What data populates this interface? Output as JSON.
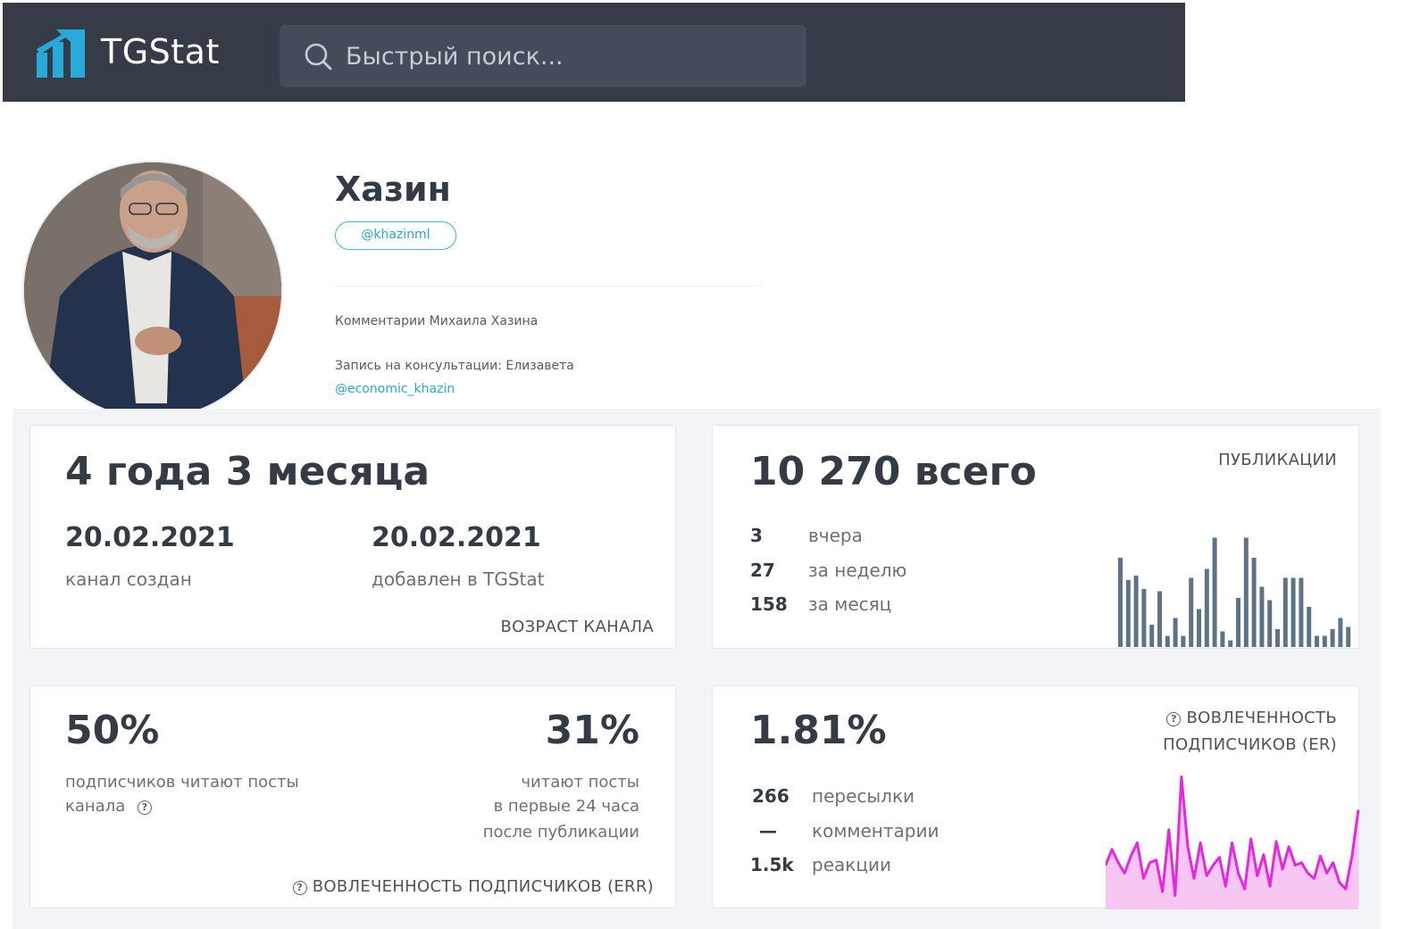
{
  "header": {
    "brand": "TGStat",
    "search_placeholder": "Быстрый поиск..."
  },
  "profile": {
    "name": "Хазин",
    "username": "@khazinml",
    "description": "Комментарии Михаила Хазина",
    "booking_text": "Запись на консультации: Елизавета",
    "booking_link": "@economic_khazin"
  },
  "age_card": {
    "value": "4 года 3 месяца",
    "created_date": "20.02.2021",
    "created_label": "канал создан",
    "added_date": "20.02.2021",
    "added_label": "добавлен в TGStat",
    "caption": "ВОЗРАСТ КАНАЛА"
  },
  "posts_card": {
    "value": "10 270 всего",
    "caption": "ПУБЛИКАЦИИ",
    "rows": [
      {
        "num": "3",
        "label": "вчера"
      },
      {
        "num": "27",
        "label": "за неделю"
      },
      {
        "num": "158",
        "label": "за месяц"
      }
    ],
    "bars": [
      4,
      3,
      3.2,
      2.6,
      1,
      2.5,
      0.5,
      1.3,
      0.5,
      3.1,
      1.7,
      3.5,
      4.9,
      0.7,
      0.3,
      2.2,
      4.9,
      4.0,
      2.7,
      2.1,
      0.8,
      3.1,
      3.1,
      3.1,
      1.8,
      0.5,
      0.5,
      0.8,
      1.3,
      0.9
    ]
  },
  "err_card": {
    "value_left": "50%",
    "label_left_1": "подписчиков читают посты",
    "label_left_2": "канала",
    "value_right": "31%",
    "label_right_1": "читают посты",
    "label_right_2": "в первые 24 часа",
    "label_right_3": "после публикации",
    "caption": "ВОВЛЕЧЕННОСТЬ ПОДПИСЧИКОВ (ERR)"
  },
  "er_card": {
    "value": "1.81%",
    "caption_1": "ВОВЛЕЧЕННОСТЬ",
    "caption_2": "ПОДПИСЧИКОВ (ER)",
    "rows": [
      {
        "num": "266",
        "label": "пересылки"
      },
      {
        "num": "—",
        "label": "комментарии"
      },
      {
        "num": "1.5k",
        "label": "реакции"
      }
    ],
    "line": [
      0.28,
      0.4,
      0.3,
      0.22,
      0.35,
      0.45,
      0.18,
      0.3,
      0.32,
      0.08,
      0.55,
      0.05,
      0.95,
      0.42,
      0.18,
      0.45,
      0.2,
      0.28,
      0.34,
      0.12,
      0.45,
      0.22,
      0.1,
      0.48,
      0.2,
      0.36,
      0.12,
      0.46,
      0.25,
      0.42,
      0.28,
      0.3,
      0.22,
      0.18,
      0.35,
      0.22,
      0.3,
      0.15,
      0.1,
      0.35,
      0.7
    ],
    "line_color": "#e726e0",
    "fill_color": "#f7c6f2"
  },
  "colors": {
    "header_bg": "#353c48",
    "accent": "#2aa6cf",
    "bar_color": "#5f7386"
  }
}
